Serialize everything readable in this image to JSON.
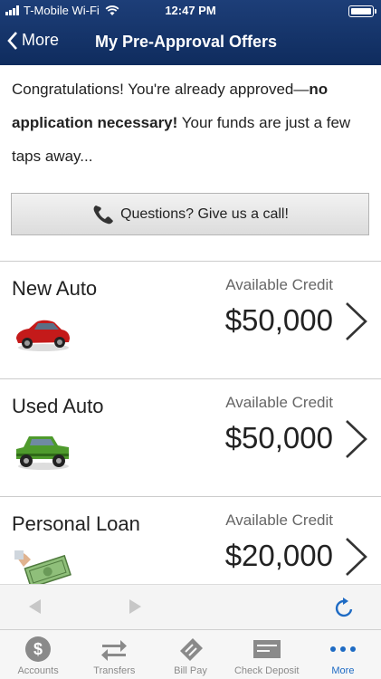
{
  "status": {
    "carrier": "T-Mobile Wi-Fi",
    "time": "12:47 PM"
  },
  "nav": {
    "back_label": "More",
    "title": "My Pre-Approval Offers"
  },
  "intro": {
    "text_before": "Congratulations! You're already approved—",
    "text_bold": "no application necessary!",
    "text_after": " Your funds are just a few taps away..."
  },
  "call_button": {
    "label": "Questions? Give us a call!"
  },
  "offers": [
    {
      "name": "New Auto",
      "credit_label": "Available Credit",
      "amount": "$50,000",
      "icon": "red-car-icon"
    },
    {
      "name": "Used Auto",
      "credit_label": "Available Credit",
      "amount": "$50,000",
      "icon": "green-jeep-icon"
    },
    {
      "name": "Personal Loan",
      "credit_label": "Available Credit",
      "amount": "$20,000",
      "icon": "cash-hand-icon"
    }
  ],
  "tabs": [
    {
      "label": "Accounts",
      "icon": "dollar-icon"
    },
    {
      "label": "Transfers",
      "icon": "transfer-arrows-icon"
    },
    {
      "label": "Bill Pay",
      "icon": "bill-icon"
    },
    {
      "label": "Check Deposit",
      "icon": "check-icon"
    },
    {
      "label": "More",
      "icon": "more-dots-icon",
      "active": true
    }
  ],
  "colors": {
    "header": "#1d3e78",
    "accent": "#1e6bc4",
    "tab_inactive": "#8a8a8a"
  }
}
